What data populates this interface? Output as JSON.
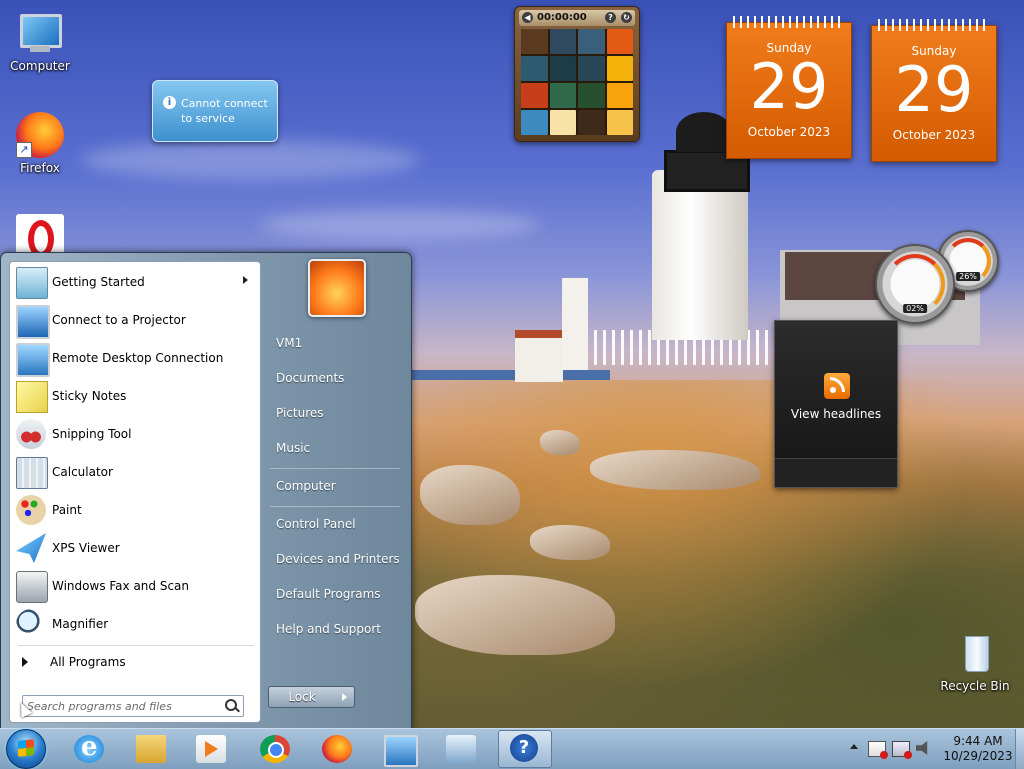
{
  "desktop_icons": [
    {
      "name": "computer",
      "label": "Computer"
    },
    {
      "name": "firefox",
      "label": "Firefox"
    },
    {
      "name": "opera",
      "label": ""
    },
    {
      "name": "recycle-bin",
      "label": "Recycle Bin"
    }
  ],
  "weather_gadget": {
    "message": "Cannot connect to service"
  },
  "puzzle_gadget": {
    "timer": "00:00:00",
    "tiles": [
      "#5b3a22",
      "#2f4a5e",
      "#3a5f7a",
      "#e35a14",
      "#2c5a6e",
      "#1e3c48",
      "#2a4758",
      "#f3b10a",
      "#c73e1a",
      "#2f6a4a",
      "#27502f",
      "#f8a20c",
      "#3b8ac0",
      "#f7e3a8",
      "#3d2a1a",
      "#f5c24a"
    ]
  },
  "calendar_gadgets": [
    {
      "dow": "Sunday",
      "day": "29",
      "month": "October 2023"
    },
    {
      "dow": "Sunday",
      "day": "29",
      "month": "October 2023"
    }
  ],
  "cpu_meter": {
    "cpu": "02%",
    "memory": "26%"
  },
  "feed_gadget": {
    "label": "View headlines"
  },
  "start_menu": {
    "programs": [
      {
        "label": "Getting Started",
        "icon": "getting-started-icon",
        "submenu": true
      },
      {
        "label": "Connect to a Projector",
        "icon": "projector-icon"
      },
      {
        "label": "Remote Desktop Connection",
        "icon": "remote-desktop-icon"
      },
      {
        "label": "Sticky Notes",
        "icon": "sticky-notes-icon"
      },
      {
        "label": "Snipping Tool",
        "icon": "snipping-tool-icon"
      },
      {
        "label": "Calculator",
        "icon": "calculator-icon"
      },
      {
        "label": "Paint",
        "icon": "paint-icon"
      },
      {
        "label": "XPS Viewer",
        "icon": "xps-viewer-icon"
      },
      {
        "label": "Windows Fax and Scan",
        "icon": "fax-scan-icon"
      },
      {
        "label": "Magnifier",
        "icon": "magnifier-icon"
      }
    ],
    "all_programs": "All Programs",
    "search_placeholder": "Search programs and files",
    "right_items": [
      "VM1",
      "Documents",
      "Pictures",
      "Music",
      "Computer",
      "Control Panel",
      "Devices and Printers",
      "Default Programs",
      "Help and Support"
    ],
    "lock_label": "Lock"
  },
  "taskbar": {
    "pinned": [
      "internet-explorer",
      "windows-explorer",
      "media-player",
      "chrome",
      "firefox",
      "remote-desktop",
      "control-panel",
      "help-and-support"
    ],
    "clock_time": "9:44 AM",
    "clock_date": "10/29/2023"
  }
}
